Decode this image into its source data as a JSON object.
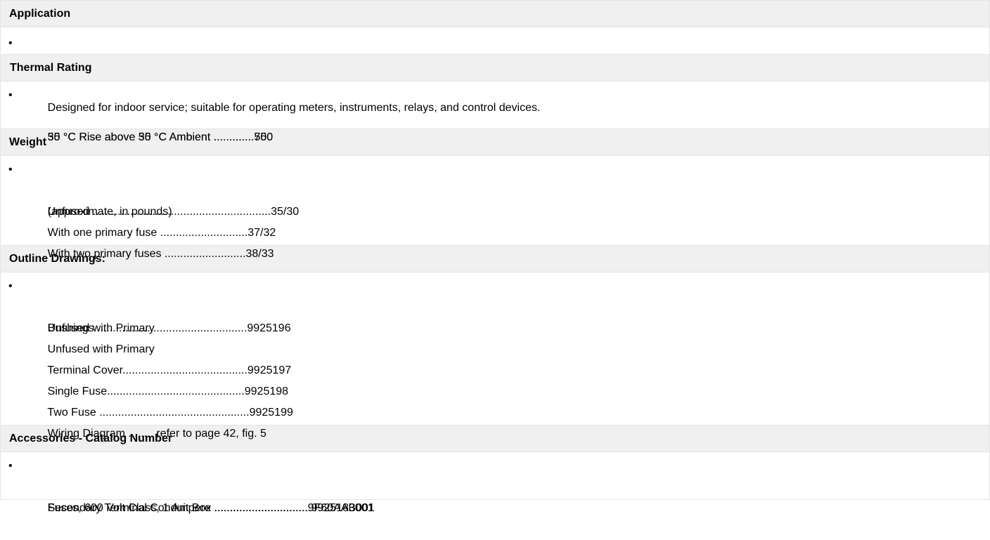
{
  "sections": {
    "application": {
      "header": "Application",
      "lines": [
        "Designed for indoor service; suitable for operating meters, instruments, relays, and control devices."
      ]
    },
    "thermal": {
      "header": "Thermal Rating",
      "lines": [
        "55 °C Rise above 30 °C Ambient .............750",
        "30 °C Rise above 55 °C Ambient .............500"
      ]
    },
    "weight": {
      "header": "Weight",
      "lines": [
        "(approximate, in pounds)",
        "Unfused .........................................................35/30",
        "With one primary fuse ............................37/32",
        "With two primary fuses ..........................38/33"
      ]
    },
    "outline": {
      "header": "Outline Drawings:",
      "lines": [
        "Unfused with Primary",
        "Bushings ................................................9925196",
        "Unfused with Primary",
        "Terminal Cover........................................9925197",
        "Single Fuse............................................9925198",
        "Two Fuse ................................................9925199",
        "Wiring Diagram ........ refer to page 42, fig. 5"
      ]
    },
    "accessories": {
      "header": "Accessories - Catalog Number",
      "lines": [
        "Fuses, 600 Volt Class, 1 Ampere ..............................9F60AAB001",
        "Secondary Terminal Conduit Box .............................. 9925183001"
      ]
    }
  },
  "bullet": "•"
}
